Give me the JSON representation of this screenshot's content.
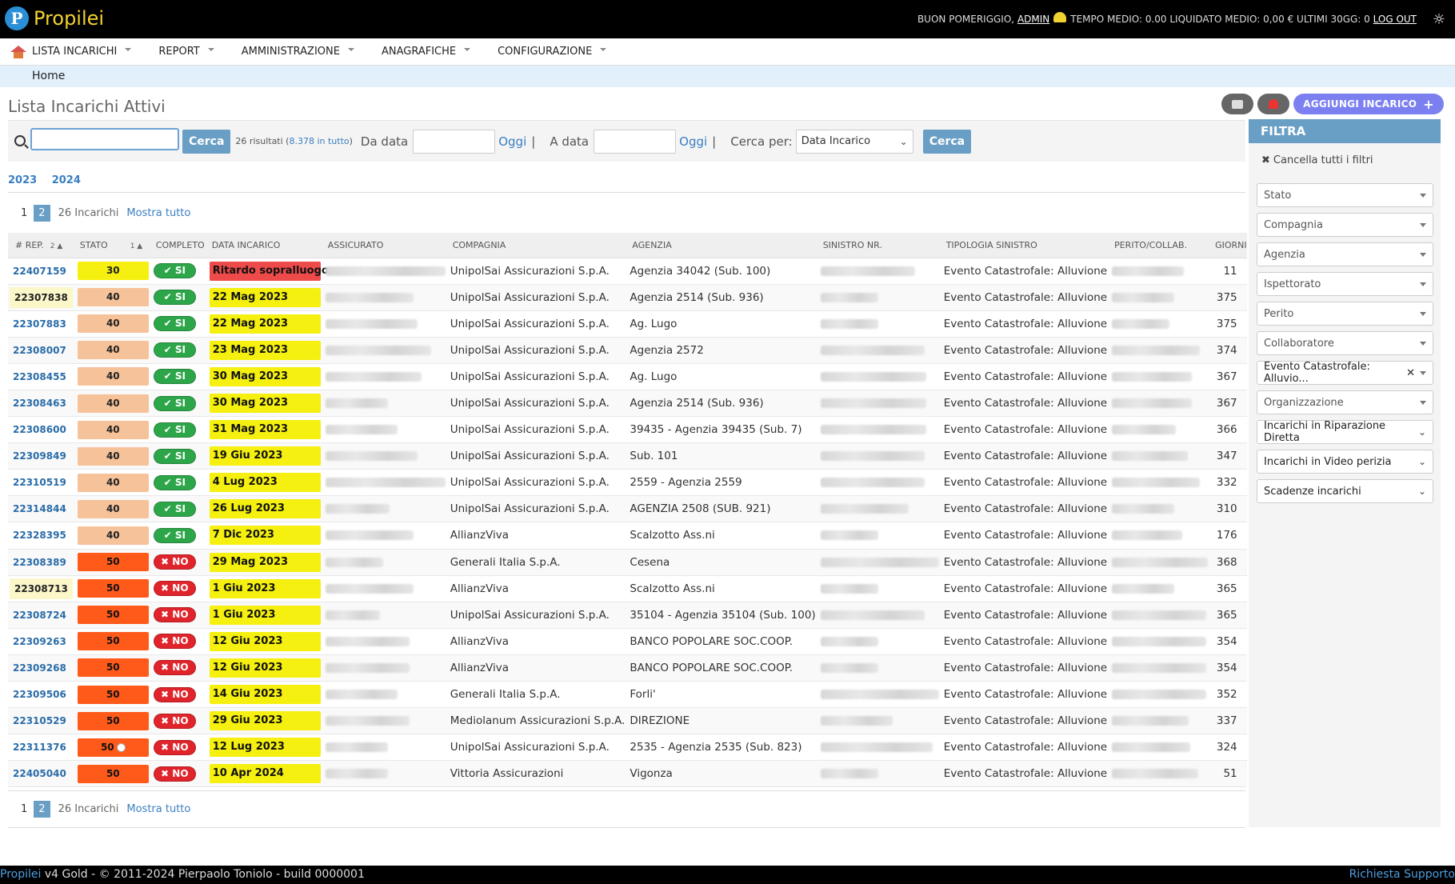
{
  "app": {
    "name": "Propilei",
    "logo_letter": "P"
  },
  "topbar": {
    "greeting": "BUON POMERIGGIO,",
    "user": "ADMIN",
    "stats": "TEMPO MEDIO: 0.00 LIQUIDATO MEDIO: 0,00 € ULTIMI 30GG: 0",
    "logout": "LOG OUT",
    "theme_icon": "☼"
  },
  "menu": {
    "items": [
      {
        "label": "LISTA INCARICHI"
      },
      {
        "label": "REPORT"
      },
      {
        "label": "AMMINISTRAZIONE"
      },
      {
        "label": "ANAGRAFICHE"
      },
      {
        "label": "CONFIGURAZIONE"
      }
    ]
  },
  "breadcrumb": {
    "home": "Home"
  },
  "page": {
    "title": "Lista Incarichi Attivi",
    "add_label": "AGGIUNGI INCARICO",
    "add_icon": "+"
  },
  "search": {
    "value": "",
    "button": "Cerca",
    "results": "26 risultati (",
    "results_total": "8.378 in tutto",
    "results_close": ")",
    "da_data": "Da data",
    "a_data": "A data",
    "oggi": "Oggi",
    "pipe": "|",
    "cerca_per": "Cerca per:",
    "cerca_per_value": "Data Incarico",
    "button2": "Cerca"
  },
  "years": [
    "2023",
    "2024"
  ],
  "pager": {
    "p1": "1",
    "p2": "2",
    "total": "26 Incarichi",
    "mostra": "Mostra tutto"
  },
  "table": {
    "headers": {
      "rep": "# REP.",
      "rep_sort": "2 ▲",
      "stato": "STATO",
      "stato_sort": "1 ▲",
      "completo": "COMPLETO",
      "data": "DATA INCARICO",
      "assicurato": "ASSICURATO",
      "compagnia": "COMPAGNIA",
      "agenzia": "AGENZIA",
      "sinistro": "SINISTRO NR.",
      "tipologia": "TIPOLOGIA SINISTRO",
      "perito": "PERITO/COLLAB.",
      "giorni": "GIORNI"
    },
    "rows": [
      {
        "rep": "22407159",
        "hl": false,
        "stato": "30",
        "completo": "✔ SI",
        "data": "Ritardo sopralluogo",
        "data_red": true,
        "compagnia": "UnipolSai Assicurazioni S.p.A.",
        "agenzia": "Agenzia 34042 (Sub. 100)",
        "tipologia": "Evento Catastrofale: Alluvione",
        "giorni": "11",
        "clock": false
      },
      {
        "rep": "22307838",
        "hl": true,
        "stato": "40",
        "completo": "✔ SI",
        "data": "22 Mag 2023",
        "data_red": false,
        "compagnia": "UnipolSai Assicurazioni S.p.A.",
        "agenzia": "Agenzia 2514 (Sub. 936)",
        "tipologia": "Evento Catastrofale: Alluvione",
        "giorni": "375",
        "clock": false
      },
      {
        "rep": "22307883",
        "hl": false,
        "stato": "40",
        "completo": "✔ SI",
        "data": "22 Mag 2023",
        "data_red": false,
        "compagnia": "UnipolSai Assicurazioni S.p.A.",
        "agenzia": "Ag. Lugo",
        "tipologia": "Evento Catastrofale: Alluvione",
        "giorni": "375",
        "clock": false
      },
      {
        "rep": "22308007",
        "hl": false,
        "stato": "40",
        "completo": "✔ SI",
        "data": "23 Mag 2023",
        "data_red": false,
        "compagnia": "UnipolSai Assicurazioni S.p.A.",
        "agenzia": "Agenzia 2572",
        "tipologia": "Evento Catastrofale: Alluvione",
        "giorni": "374",
        "clock": false
      },
      {
        "rep": "22308455",
        "hl": false,
        "stato": "40",
        "completo": "✔ SI",
        "data": "30 Mag 2023",
        "data_red": false,
        "compagnia": "UnipolSai Assicurazioni S.p.A.",
        "agenzia": "Ag. Lugo",
        "tipologia": "Evento Catastrofale: Alluvione",
        "giorni": "367",
        "clock": false
      },
      {
        "rep": "22308463",
        "hl": false,
        "stato": "40",
        "completo": "✔ SI",
        "data": "30 Mag 2023",
        "data_red": false,
        "compagnia": "UnipolSai Assicurazioni S.p.A.",
        "agenzia": "Agenzia 2514 (Sub. 936)",
        "tipologia": "Evento Catastrofale: Alluvione",
        "giorni": "367",
        "clock": false
      },
      {
        "rep": "22308600",
        "hl": false,
        "stato": "40",
        "completo": "✔ SI",
        "data": "31 Mag 2023",
        "data_red": false,
        "compagnia": "UnipolSai Assicurazioni S.p.A.",
        "agenzia": "39435 - Agenzia 39435 (Sub. 7)",
        "tipologia": "Evento Catastrofale: Alluvione",
        "giorni": "366",
        "clock": false
      },
      {
        "rep": "22309849",
        "hl": false,
        "stato": "40",
        "completo": "✔ SI",
        "data": "19 Giu 2023",
        "data_red": false,
        "compagnia": "UnipolSai Assicurazioni S.p.A.",
        "agenzia": "Sub. 101",
        "tipologia": "Evento Catastrofale: Alluvione",
        "giorni": "347",
        "clock": false
      },
      {
        "rep": "22310519",
        "hl": false,
        "stato": "40",
        "completo": "✔ SI",
        "data": "4 Lug 2023",
        "data_red": false,
        "compagnia": "UnipolSai Assicurazioni S.p.A.",
        "agenzia": "2559 - Agenzia 2559",
        "tipologia": "Evento Catastrofale: Alluvione",
        "giorni": "332",
        "clock": false
      },
      {
        "rep": "22314844",
        "hl": false,
        "stato": "40",
        "completo": "✔ SI",
        "data": "26 Lug 2023",
        "data_red": false,
        "compagnia": "UnipolSai Assicurazioni S.p.A.",
        "agenzia": "AGENZIA 2508 (SUB. 921)",
        "tipologia": "Evento Catastrofale: Alluvione",
        "giorni": "310",
        "clock": false
      },
      {
        "rep": "22328395",
        "hl": false,
        "stato": "40",
        "completo": "✔ SI",
        "data": "7 Dic 2023",
        "data_red": false,
        "compagnia": "AllianzViva",
        "agenzia": "Scalzotto Ass.ni",
        "tipologia": "Evento Catastrofale: Alluvione",
        "giorni": "176",
        "clock": false
      },
      {
        "rep": "22308389",
        "hl": false,
        "stato": "50",
        "completo": "✖ NO",
        "data": "29 Mag 2023",
        "data_red": false,
        "compagnia": "Generali Italia S.p.A.",
        "agenzia": "Cesena",
        "tipologia": "Evento Catastrofale: Alluvione",
        "giorni": "368",
        "clock": false
      },
      {
        "rep": "22308713",
        "hl": true,
        "stato": "50",
        "completo": "✖ NO",
        "data": "1 Giu 2023",
        "data_red": false,
        "compagnia": "AllianzViva",
        "agenzia": "Scalzotto Ass.ni",
        "tipologia": "Evento Catastrofale: Alluvione",
        "giorni": "365",
        "clock": false
      },
      {
        "rep": "22308724",
        "hl": false,
        "stato": "50",
        "completo": "✖ NO",
        "data": "1 Giu 2023",
        "data_red": false,
        "compagnia": "UnipolSai Assicurazioni S.p.A.",
        "agenzia": "35104 - Agenzia 35104 (Sub. 100)",
        "tipologia": "Evento Catastrofale: Alluvione",
        "giorni": "365",
        "clock": false
      },
      {
        "rep": "22309263",
        "hl": false,
        "stato": "50",
        "completo": "✖ NO",
        "data": "12 Giu 2023",
        "data_red": false,
        "compagnia": "AllianzViva",
        "agenzia": "BANCO POPOLARE SOC.COOP.",
        "tipologia": "Evento Catastrofale: Alluvione",
        "giorni": "354",
        "clock": false
      },
      {
        "rep": "22309268",
        "hl": false,
        "stato": "50",
        "completo": "✖ NO",
        "data": "12 Giu 2023",
        "data_red": false,
        "compagnia": "AllianzViva",
        "agenzia": "BANCO POPOLARE SOC.COOP.",
        "tipologia": "Evento Catastrofale: Alluvione",
        "giorni": "354",
        "clock": false
      },
      {
        "rep": "22309506",
        "hl": false,
        "stato": "50",
        "completo": "✖ NO",
        "data": "14 Giu 2023",
        "data_red": false,
        "compagnia": "Generali Italia S.p.A.",
        "agenzia": "Forli'",
        "tipologia": "Evento Catastrofale: Alluvione",
        "giorni": "352",
        "clock": false
      },
      {
        "rep": "22310529",
        "hl": false,
        "stato": "50",
        "completo": "✖ NO",
        "data": "29 Giu 2023",
        "data_red": false,
        "compagnia": "Mediolanum Assicurazioni S.p.A.",
        "agenzia": "DIREZIONE",
        "tipologia": "Evento Catastrofale: Alluvione",
        "giorni": "337",
        "clock": false
      },
      {
        "rep": "22311376",
        "hl": false,
        "stato": "50",
        "completo": "✖ NO",
        "data": "12 Lug 2023",
        "data_red": false,
        "compagnia": "UnipolSai Assicurazioni S.p.A.",
        "agenzia": "2535 - Agenzia 2535 (Sub. 823)",
        "tipologia": "Evento Catastrofale: Alluvione",
        "giorni": "324",
        "clock": true
      },
      {
        "rep": "22405040",
        "hl": false,
        "stato": "50",
        "completo": "✖ NO",
        "data": "10 Apr 2024",
        "data_red": false,
        "compagnia": "Vittoria Assicurazioni",
        "agenzia": "Vigonza",
        "tipologia": "Evento Catastrofale: Alluvione",
        "giorni": "51",
        "clock": false
      }
    ]
  },
  "sidebar": {
    "title": "FILTRA",
    "cancella": "Cancella tutti i filtri",
    "cancella_icon": "✖",
    "fields": [
      {
        "label": "Stato",
        "type": "dd"
      },
      {
        "label": "Compagnia",
        "type": "dd"
      },
      {
        "label": "Agenzia",
        "type": "dd"
      },
      {
        "label": "Ispettorato",
        "type": "dd"
      },
      {
        "label": "Perito",
        "type": "dd"
      },
      {
        "label": "Collaboratore",
        "type": "dd"
      },
      {
        "label": "Evento Catastrofale: Alluvio...",
        "type": "selected"
      },
      {
        "label": "Organizzazione",
        "type": "dd"
      },
      {
        "label": "Incarichi in Riparazione Diretta",
        "type": "select"
      },
      {
        "label": "Incarichi in Video perizia",
        "type": "select"
      },
      {
        "label": "Scadenze incarichi",
        "type": "select"
      }
    ]
  },
  "footer": {
    "brand": "Propilei",
    "text": " v4 Gold - © 2011-2024 Pierpaolo Toniolo - build 0000001",
    "support": "Richiesta Supporto"
  },
  "colors": {
    "stato30": "#f5f00f",
    "stato40": "#f6c29a",
    "stato50": "#ff5a1a",
    "si": "#2da64a",
    "no": "#e0242b",
    "accent": "#6a9fc5"
  }
}
